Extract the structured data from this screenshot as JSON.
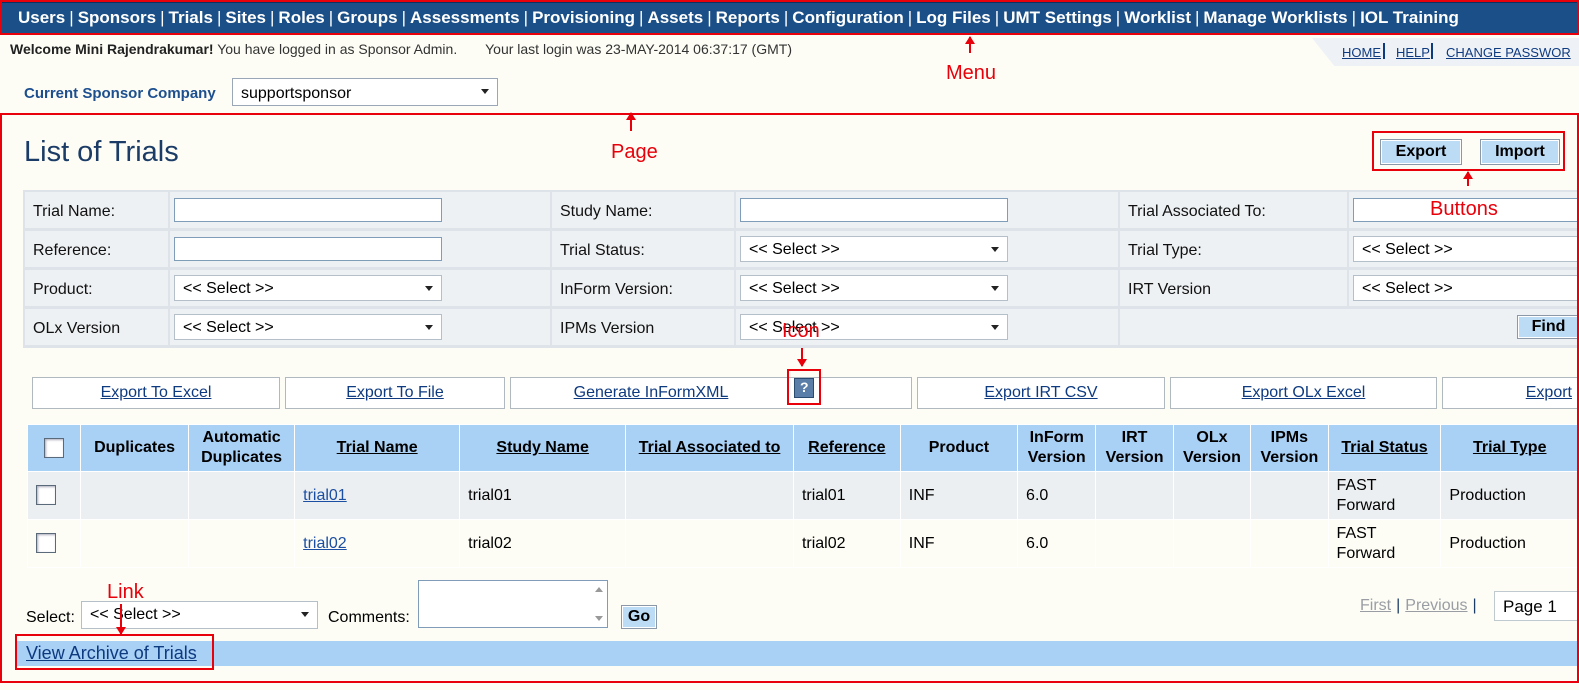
{
  "menu": {
    "items": [
      "Users",
      "Sponsors",
      "Trials",
      "Sites",
      "Roles",
      "Groups",
      "Assessments",
      "Provisioning",
      "Assets",
      "Reports",
      "Configuration",
      "Log Files",
      "UMT Settings",
      "Worklist",
      "Manage Worklists",
      "IOL Training"
    ],
    "separator": "|"
  },
  "header": {
    "welcome_bold": "Welcome Mini Rajendrakumar!",
    "welcome_text": "You have logged in as Sponsor Admin.",
    "last_login": "Your last login was 23-MAY-2014 06:37:17  (GMT)",
    "links": [
      "HOME",
      "HELP",
      "CHANGE PASSWOR"
    ]
  },
  "company": {
    "label": "Current Sponsor Company",
    "value": "supportsponsor"
  },
  "page": {
    "title": "List of Trials",
    "export_button": "Export",
    "import_button": "Import"
  },
  "search": {
    "trial_name": "Trial Name:",
    "study_name": "Study Name:",
    "trial_associated_to": "Trial Associated To:",
    "reference": "Reference:",
    "trial_status": "Trial Status:",
    "trial_type": "Trial Type:",
    "product": "Product:",
    "inform_version": "InForm Version:",
    "irt_version": "IRT Version",
    "olx_version": "OLx Version",
    "ipms_version": "IPMs Version",
    "select_placeholder": "<< Select >>",
    "find_button": "Find"
  },
  "export_bar": [
    "Export To Excel",
    "Export To File",
    "Generate InFormXML",
    "Export IRT CSV",
    "Export OLx Excel",
    "Export"
  ],
  "table": {
    "headers": [
      "Duplicates",
      "Automatic Duplicates",
      "Trial Name",
      "Study Name",
      "Trial Associated to",
      "Reference",
      "Product",
      "InForm Version",
      "IRT Version",
      "OLx Version",
      "IPMs Version",
      "Trial Status",
      "Trial Type"
    ],
    "rows": [
      {
        "trial_name": "trial01",
        "study_name": "trial01",
        "reference": "trial01",
        "product": "INF",
        "inform_version": "6.0",
        "trial_status": "FAST Forward",
        "trial_type": "Production"
      },
      {
        "trial_name": "trial02",
        "study_name": "trial02",
        "reference": "trial02",
        "product": "INF",
        "inform_version": "6.0",
        "trial_status": "FAST Forward",
        "trial_type": "Production"
      }
    ]
  },
  "bottom": {
    "select_label": "Select:",
    "select_value": "<< Select >>",
    "comments_label": "Comments:",
    "go_button": "Go",
    "pager_first": "First",
    "pager_previous": "Previous",
    "pager_sep": "|",
    "page_value": "Page 1",
    "archive_link": "View Archive of Trials"
  },
  "annotations": {
    "menu": "Menu",
    "page": "Page",
    "buttons": "Buttons",
    "icon": "Icon",
    "link": "Link"
  },
  "colors": {
    "menu_bg": "#1b4f87",
    "header_bg": "#a9d0f5",
    "annotation": "#e8000a"
  }
}
